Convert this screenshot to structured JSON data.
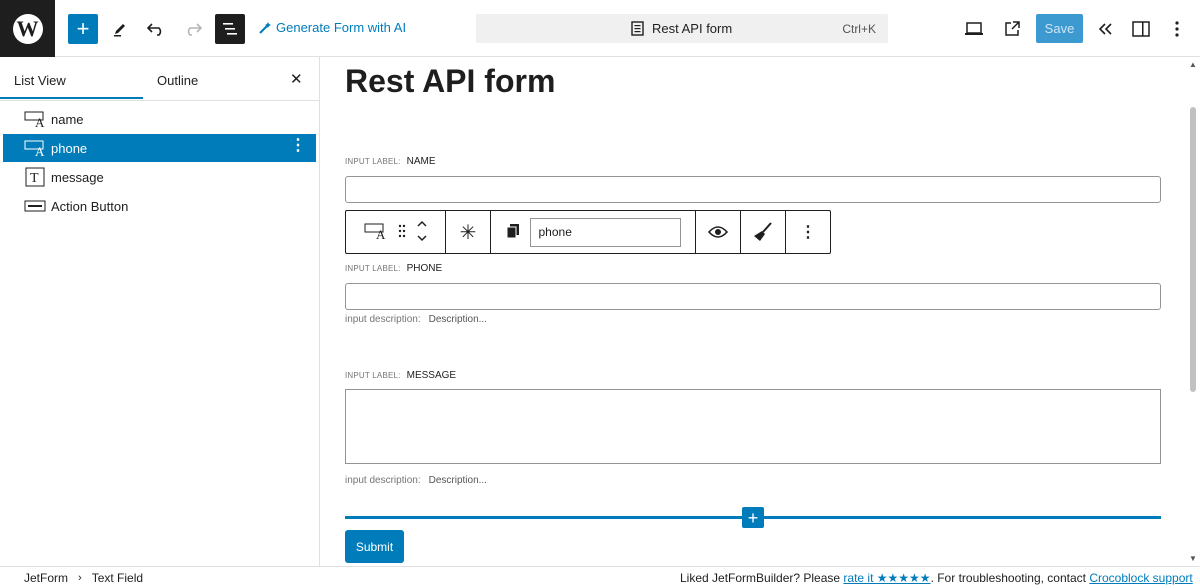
{
  "header": {
    "ai_label": "Generate Form with AI",
    "doc_title": "Rest API form",
    "shortcut": "Ctrl+K",
    "save_label": "Save"
  },
  "sidebar": {
    "tabs": [
      {
        "label": "List View",
        "active": true
      },
      {
        "label": "Outline",
        "active": false
      }
    ],
    "items": [
      {
        "label": "name",
        "icon": "text-field-icon",
        "selected": false
      },
      {
        "label": "phone",
        "icon": "text-field-icon",
        "selected": true
      },
      {
        "label": "message",
        "icon": "textarea-icon",
        "selected": false
      },
      {
        "label": "Action Button",
        "icon": "action-button-icon",
        "selected": false
      }
    ]
  },
  "canvas": {
    "title": "Rest API form",
    "label_prefix": "input label:",
    "desc_prefix": "input description:",
    "desc_placeholder": "Description...",
    "fields": [
      {
        "label": "NAME"
      },
      {
        "label": "PHONE"
      },
      {
        "label": "MESSAGE"
      }
    ],
    "toolbar_field_name": "phone",
    "submit_label": "Submit"
  },
  "footer": {
    "breadcrumb": [
      "JetForm",
      "Text Field"
    ],
    "note_prefix": "Liked JetFormBuilder? Please ",
    "rate_link": "rate it ★★★★★",
    "note_middle": ". For troubleshooting, contact ",
    "support_link": "Crocoblock support"
  },
  "colors": {
    "accent": "#007cba",
    "dark": "#1e1e1e"
  }
}
